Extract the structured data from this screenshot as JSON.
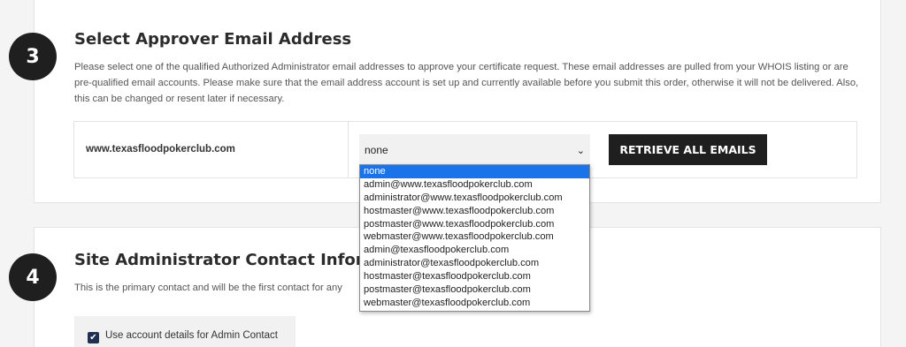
{
  "section3": {
    "step": "3",
    "title": "Select Approver Email Address",
    "description": "Please select one of the qualified Authorized Administrator email addresses to approve your certificate request. These email addresses are pulled from your WHOIS listing or are pre-qualified email accounts. Please make sure that the email address account is set up and currently available before you submit this order, otherwise it will not be delivered. Also, this can be changed or resent later if necessary.",
    "domain": "www.texasfloodpokerclub.com",
    "selected_email": "none",
    "retrieve_label": "RETRIEVE ALL EMAILS",
    "email_options": [
      "none",
      "admin@www.texasfloodpokerclub.com",
      "administrator@www.texasfloodpokerclub.com",
      "hostmaster@www.texasfloodpokerclub.com",
      "postmaster@www.texasfloodpokerclub.com",
      "webmaster@www.texasfloodpokerclub.com",
      "admin@texasfloodpokerclub.com",
      "administrator@texasfloodpokerclub.com",
      "hostmaster@texasfloodpokerclub.com",
      "postmaster@texasfloodpokerclub.com",
      "webmaster@texasfloodpokerclub.com"
    ]
  },
  "section4": {
    "step": "4",
    "title": "Site Administrator Contact Informati",
    "description": "This is the primary contact and will be the first contact for any",
    "checkbox_label": "Use account details for Admin Contact",
    "checkbox_checked": true
  },
  "icons": {
    "chevron": "chevron-down-icon",
    "check": "check-icon"
  },
  "colors": {
    "dark": "#1f1f1f",
    "selected_option": "#1a73e8",
    "checkbox": "#1f3050"
  }
}
